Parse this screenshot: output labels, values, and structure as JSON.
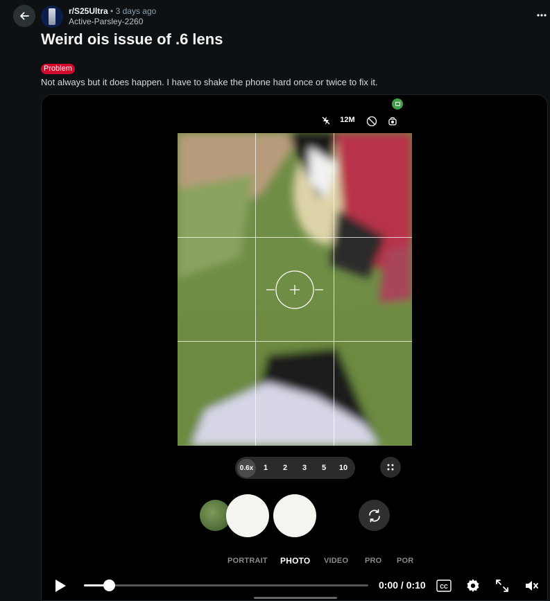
{
  "post": {
    "subreddit": "r/S25Ultra",
    "separator": "•",
    "time_ago": "3 days ago",
    "author": "Active-Parsley-2260",
    "title": "Weird ois issue of .6 lens",
    "flair": "Problem",
    "body": "Not always but it does happen. I have to shake the phone hard once or twice to fix it."
  },
  "camera": {
    "resolution": "12M",
    "zoom_levels": [
      "0.6x",
      "1",
      "2",
      "3",
      "5",
      "10"
    ],
    "active_zoom": "0.6x",
    "modes": [
      "PORTRAIT",
      "PHOTO",
      "VIDEO",
      "PRO",
      "POR"
    ],
    "active_mode": "PHOTO"
  },
  "player": {
    "timecode": "0:00 / 0:10",
    "progress": 0.09,
    "cc_label": "CC"
  },
  "colors": {
    "background": "#0e1113",
    "flair": "#d20b2a",
    "record_indicator": "#3ea346"
  },
  "icons": [
    "back-arrow-icon",
    "more-options-icon",
    "flash-off-icon",
    "timer-icon",
    "motion-photo-icon",
    "grid-dots-icon",
    "switch-camera-icon",
    "play-icon",
    "captions-icon",
    "settings-gear-icon",
    "fullscreen-icon",
    "mute-icon"
  ]
}
